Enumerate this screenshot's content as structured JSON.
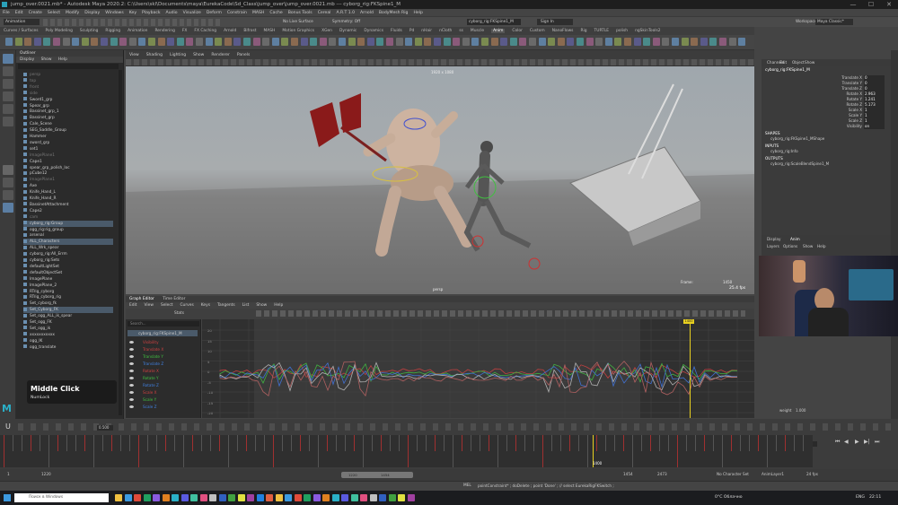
{
  "window": {
    "title": "jump_over.0021.mb* - Autodesk Maya 2020.2: C:\\Users\\skl\\Documents\\maya\\EurekaCode\\Sd_Class\\jump_over\\jump_over.0021.mb  ---  cyborg_rig:FKSpine1_M",
    "controls": [
      "—",
      "☐",
      "✕"
    ]
  },
  "menubar": [
    "File",
    "Edit",
    "Create",
    "Select",
    "Modify",
    "Display",
    "Windows",
    "Key",
    "Playback",
    "Audio",
    "Visualize",
    "Deform",
    "Constrain",
    "MASH",
    "Cache",
    "Bonus Tools",
    "Cereal",
    "A.R.T 1.0",
    "Arnold",
    "BodyMesh Rig",
    "Help"
  ],
  "workspace": {
    "label": "Workspace:",
    "value": "Maya Classic*"
  },
  "status_line": {
    "mode": "Animation",
    "no_live_surface": "No Live Surface",
    "symmetry": "Symmetry: Off",
    "selected_field": "cyborg_rig:FKSpine1_M",
    "sign_in": "Sign In"
  },
  "shelf_tabs": [
    "Curves / Surfaces",
    "Poly Modeling",
    "Sculpting",
    "Rigging",
    "Animation",
    "Rendering",
    "FX",
    "FX Caching",
    "Arnold",
    "Bifrost",
    "MASH",
    "Motion Graphics",
    "XGen",
    "Dynamic",
    "Dynamics",
    "Fluids",
    "Pd",
    "nHair",
    "nCloth",
    "ss",
    "Muscle",
    "Anim",
    "Color",
    "Custom",
    "NanoFlows",
    "Rig",
    "TURTLE",
    "polish",
    "ngSkinTools2"
  ],
  "active_shelf": "Anim",
  "outliner": {
    "title": "Outliner",
    "menu": [
      "Display",
      "Show",
      "Help"
    ],
    "items": [
      {
        "label": "persp",
        "dim": true
      },
      {
        "label": "top",
        "dim": true
      },
      {
        "label": "front",
        "dim": true
      },
      {
        "label": "side",
        "dim": true
      },
      {
        "label": "Sword1_grp",
        "dim": false
      },
      {
        "label": "Spear_grp",
        "dim": false
      },
      {
        "label": "Bassinet_grp_1",
        "dim": false
      },
      {
        "label": "Bassinet_grp",
        "dim": false
      },
      {
        "label": "Cale_Scene",
        "dim": false
      },
      {
        "label": "SEG_Saddle_Group",
        "dim": false
      },
      {
        "label": "Hammer",
        "dim": false
      },
      {
        "label": "sword_grp",
        "dim": false
      },
      {
        "label": "set1",
        "dim": false
      },
      {
        "label": "ImagePlane1",
        "dim": true
      },
      {
        "label": "Cape1",
        "dim": false
      },
      {
        "label": "spear_grp_polish_loc",
        "dim": false
      },
      {
        "label": "pCube12",
        "dim": false
      },
      {
        "label": "ImagePlane1",
        "dim": true
      },
      {
        "label": "Axe",
        "dim": false
      },
      {
        "label": "Knife_Hand_L",
        "dim": false
      },
      {
        "label": "Knife_Hand_R",
        "dim": false
      },
      {
        "label": "BassinetAttachment",
        "dim": false
      },
      {
        "label": "Cape2",
        "dim": false
      },
      {
        "label": "cam",
        "dim": true
      },
      {
        "label": "cyborg_rig:Group",
        "dim": false
      },
      {
        "label": "ogg_rig:rig_group",
        "dim": false
      },
      {
        "label": "arsenal",
        "dim": false
      },
      {
        "label": "ALL_Characters",
        "dim": false
      },
      {
        "label": "ALL_Wrk_spear",
        "dim": false
      },
      {
        "label": "cyborg_rig:All_Errm",
        "dim": false
      },
      {
        "label": "cyborg_rig:Sets",
        "dim": false
      },
      {
        "label": "defaultLightSet",
        "dim": false
      },
      {
        "label": "defaultObjectSet",
        "dim": false
      },
      {
        "label": "ImagePlane",
        "dim": false
      },
      {
        "label": "ImagePlane_2",
        "dim": false
      },
      {
        "label": "RTrig_cyborg",
        "dim": false
      },
      {
        "label": "RTrig_cyborg_rig",
        "dim": false
      },
      {
        "label": "Set_cyborg_fk",
        "dim": false
      },
      {
        "label": "Set_Cyborg_FK",
        "dim": false
      },
      {
        "label": "Set_ogg_ALL_ik_spear",
        "dim": false
      },
      {
        "label": "Set_ogg_FK",
        "dim": false
      },
      {
        "label": "Set_ogg_ik",
        "dim": false
      },
      {
        "label": "xxxxxxxxxxx",
        "dim": false
      },
      {
        "label": "ogg_IK",
        "dim": false
      },
      {
        "label": "ogg_translate",
        "dim": false
      }
    ],
    "selected_indices": [
      24,
      27,
      38
    ]
  },
  "overlay": {
    "title": "Middle Click",
    "subtitle": "NumLock"
  },
  "viewport": {
    "menu": [
      "View",
      "Shading",
      "Lighting",
      "Show",
      "Renderer",
      "Panels"
    ],
    "camera_label": "persp",
    "resolution_text": "1920 x 1080",
    "frame_label": "Frame:",
    "frame_value": "1450",
    "fps": "25.4 fps"
  },
  "graph_editor": {
    "tabs": [
      "Graph Editor",
      "Time Editor"
    ],
    "menu": [
      "Edit",
      "View",
      "Select",
      "Curves",
      "Keys",
      "Tangents",
      "List",
      "Show",
      "Help"
    ],
    "menu2_stats": "Stats",
    "list_header": "cyborg_rig:FKSpine1_M",
    "search_placeholder": "Search...",
    "channels": [
      {
        "label": "Visibility",
        "color": "#d04040"
      },
      {
        "label": "Translate X",
        "color": "#d04040"
      },
      {
        "label": "Translate Y",
        "color": "#40c040"
      },
      {
        "label": "Translate Z",
        "color": "#4080e0"
      },
      {
        "label": "Rotate X",
        "color": "#d04040"
      },
      {
        "label": "Rotate Y",
        "color": "#40c040"
      },
      {
        "label": "Rotate Z",
        "color": "#4080e0"
      },
      {
        "label": "Scale X",
        "color": "#d04040"
      },
      {
        "label": "Scale Y",
        "color": "#40c040"
      },
      {
        "label": "Scale Z",
        "color": "#4080e0"
      }
    ],
    "y_ticks": [
      "20",
      "15",
      "10",
      "5",
      "0",
      "-5",
      "-10",
      "-15",
      "-20"
    ],
    "current_frame_marker": "1400",
    "top_markers": [
      "1350",
      "1450",
      "1484"
    ]
  },
  "channel_box": {
    "tabs": [
      "Channels",
      "Edit",
      "Object",
      "Show"
    ],
    "object": "cyborg_rig:FKSpine1_M",
    "attributes": [
      {
        "label": "Translate X",
        "value": "0"
      },
      {
        "label": "Translate Y",
        "value": "0"
      },
      {
        "label": "Translate Z",
        "value": "0"
      },
      {
        "label": "Rotate X",
        "value": "2.963"
      },
      {
        "label": "Rotate Y",
        "value": "1.241"
      },
      {
        "label": "Rotate Z",
        "value": "5.173"
      },
      {
        "label": "Scale X",
        "value": "1"
      },
      {
        "label": "Scale Y",
        "value": "1"
      },
      {
        "label": "Scale Z",
        "value": "1"
      },
      {
        "label": "Visibility",
        "value": "on"
      }
    ],
    "sections": [
      {
        "title": "SHAPES",
        "item": "cyborg_rig:FKSpine1_MShape"
      },
      {
        "title": "INPUTS",
        "item": "cyborg_rig:Info"
      },
      {
        "title": "OUTPUTS",
        "item": "cyborg_rig:ScaleBlendSpine1_M"
      }
    ],
    "layer_tabs": [
      "Display",
      "Anim"
    ],
    "layer_menu": [
      "Layers",
      "Options",
      "Show",
      "Help"
    ]
  },
  "time_slider": {
    "current_frame": "1400",
    "start_field": "1",
    "range_start": "1220",
    "range_end_inner": "1454",
    "range_end": "1454",
    "end_field": "2473",
    "character_set": "No Character Set",
    "anim_layer": "AnimLayer1",
    "fps": "24 fps",
    "step_field": "0.500",
    "weight_label": "weight",
    "weight_value": "1.000",
    "zoom_value": "1400"
  },
  "command_line": {
    "label": "MEL",
    "text": "pointConstraint* ; doDelete ; point 'Done' ;  // select EurekaRigFKSwitch ;"
  },
  "taskbar": {
    "search_placeholder": "Поиск в Windows",
    "weather": "0°C Облачно",
    "lang": "ENG",
    "time": "22:11"
  }
}
